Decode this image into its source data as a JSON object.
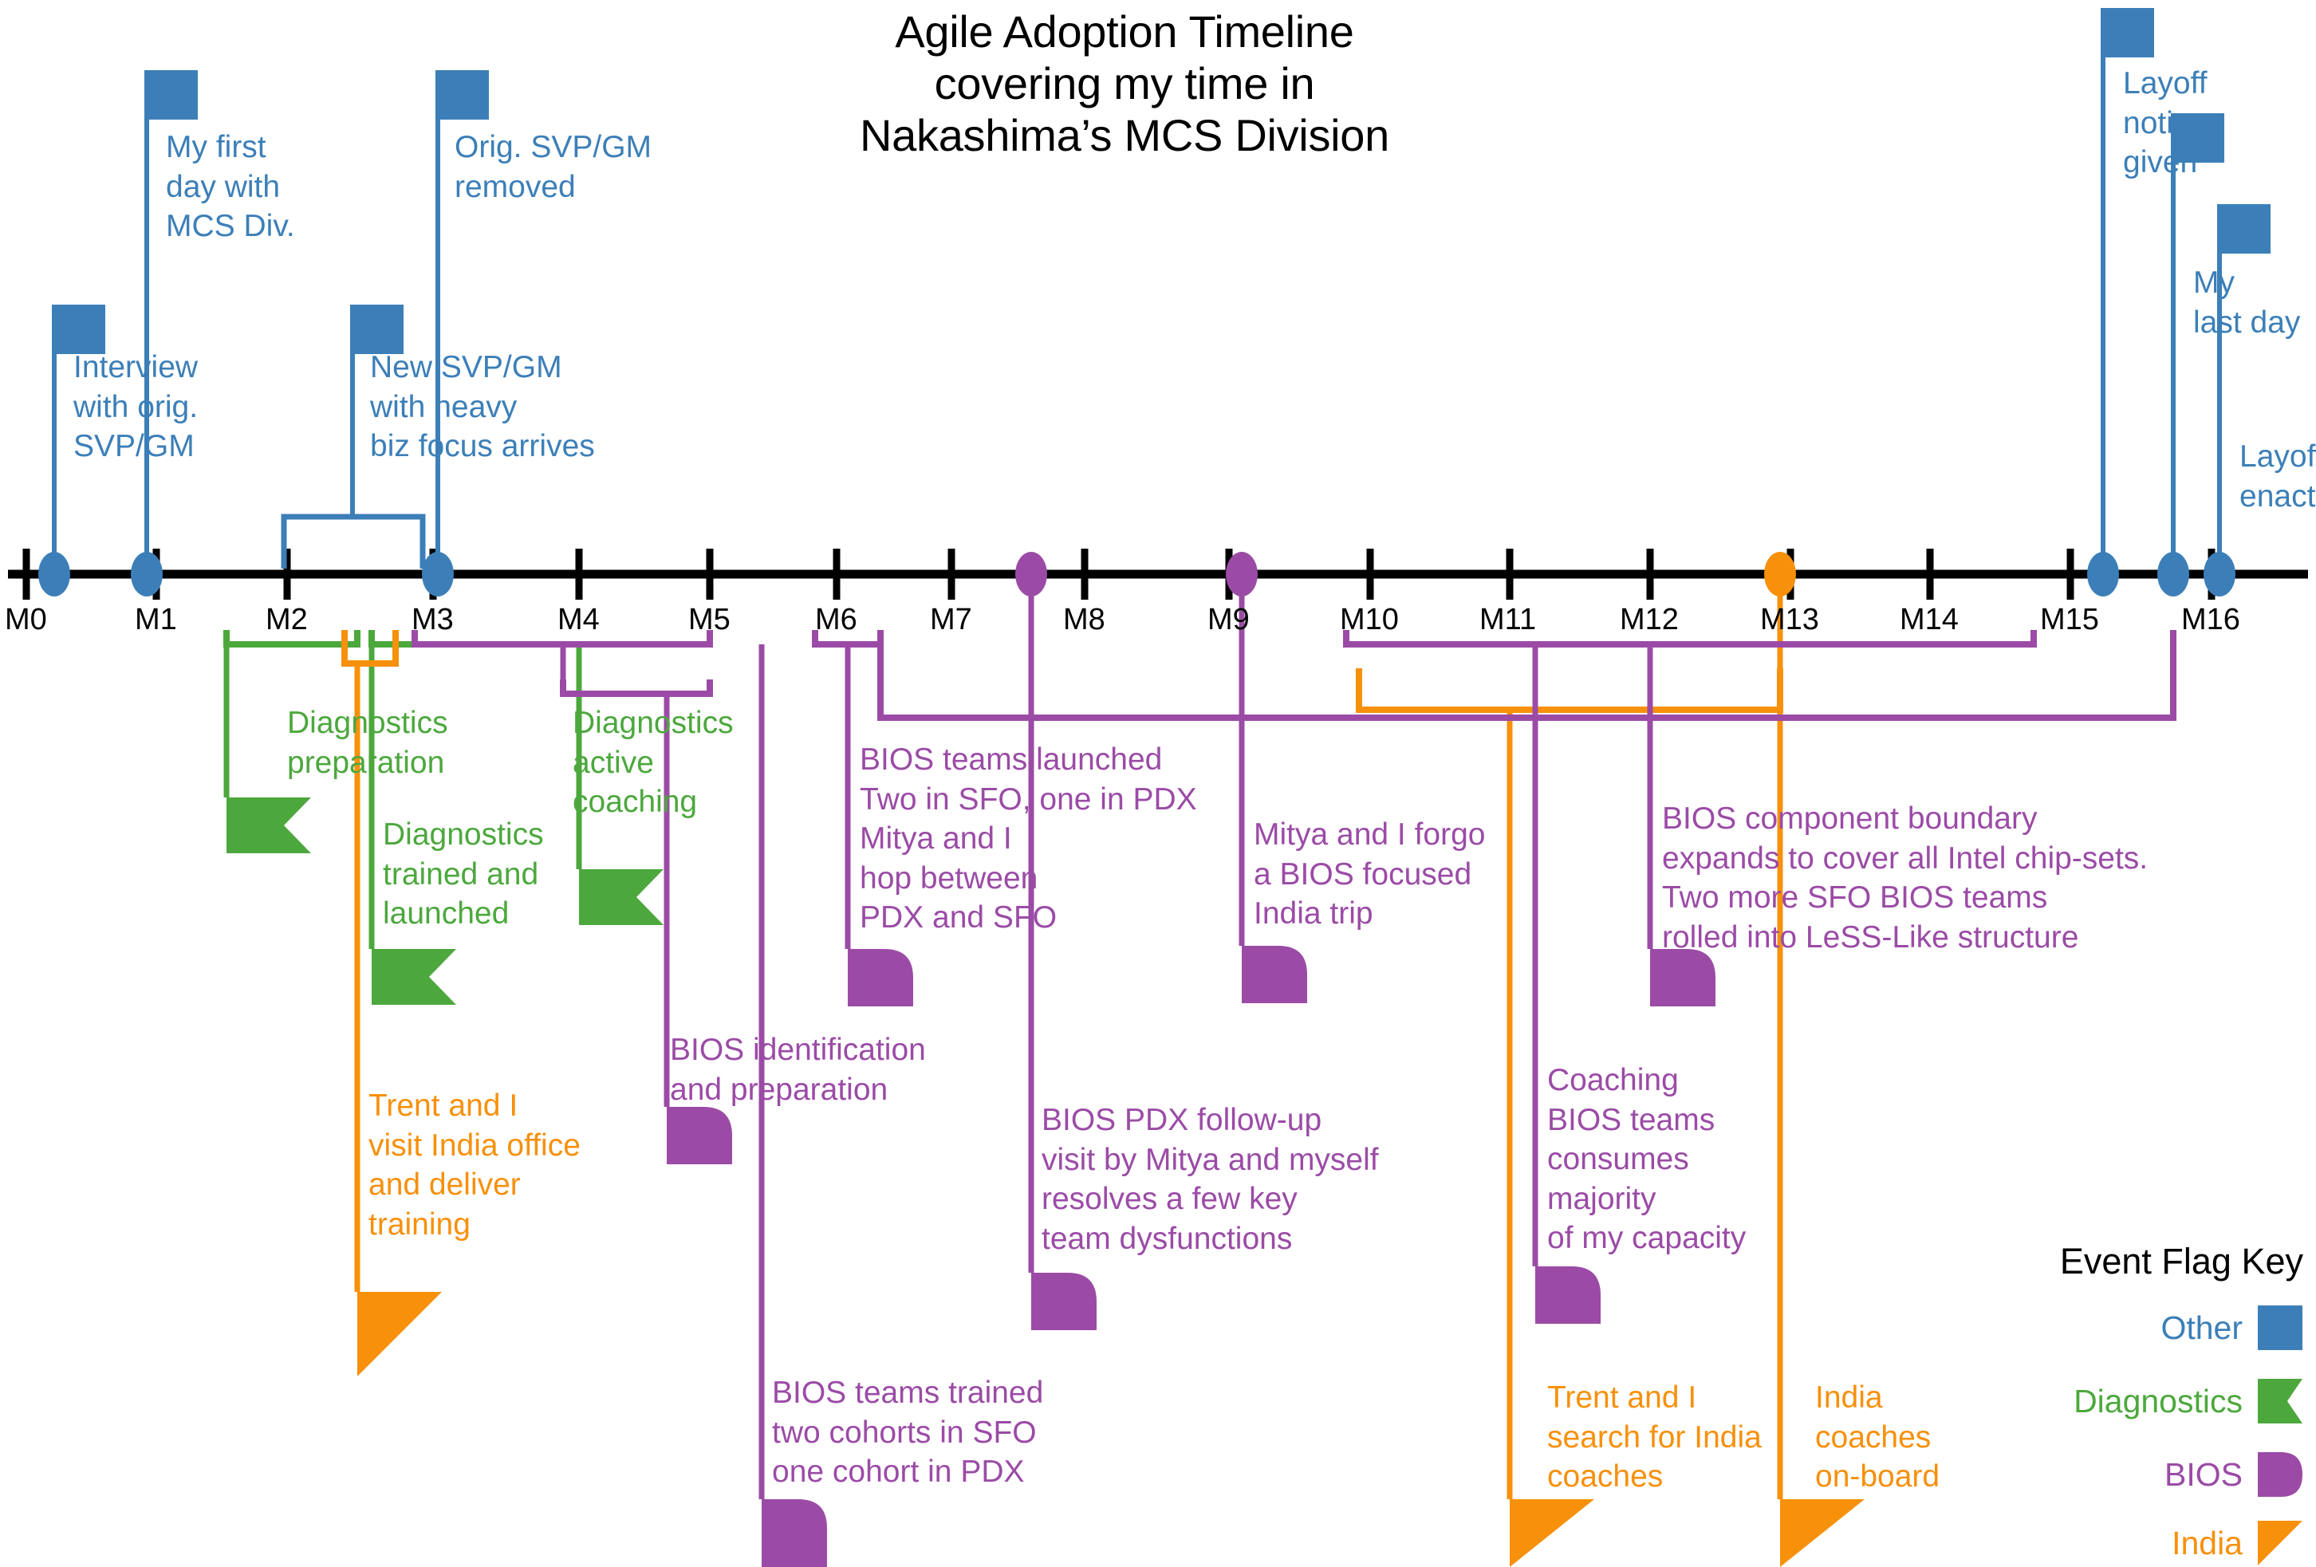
{
  "title": "Agile Adoption Timeline\ncovering my time in\nNakashima’s MCS Division",
  "colors": {
    "other": "#3C7FB8",
    "diagnostics": "#4CA83D",
    "bios": "#9B4BA6",
    "india": "#F7900B",
    "axis": "#000000"
  },
  "axis": {
    "ticks": [
      "M0",
      "M1",
      "M2",
      "M3",
      "M4",
      "M5",
      "M6",
      "M7",
      "M8",
      "M9",
      "M10",
      "M11",
      "M12",
      "M13",
      "M14",
      "M15",
      "M16"
    ]
  },
  "legend": {
    "title": "Event Flag Key",
    "items": [
      {
        "label": "Other",
        "shape": "square-flag-icon",
        "color": "#3C7FB8"
      },
      {
        "label": "Diagnostics",
        "shape": "notched-flag-icon",
        "color": "#4CA83D"
      },
      {
        "label": "BIOS",
        "shape": "rounded-flag-icon",
        "color": "#9B4BA6"
      },
      {
        "label": "India",
        "shape": "triangle-flag-icon",
        "color": "#F7900B"
      }
    ]
  },
  "events": [
    {
      "id": "interview",
      "category": "Other",
      "text": "Interview\nwith orig.\nSVP/GM"
    },
    {
      "id": "first-day",
      "category": "Other",
      "text": "My first\nday with\nMCS Div."
    },
    {
      "id": "new-svp",
      "category": "Other",
      "text": "New SVP/GM\nwith heavy\nbiz focus arrives"
    },
    {
      "id": "orig-svp-removed",
      "category": "Other",
      "text": "Orig. SVP/GM\nremoved"
    },
    {
      "id": "layoff-notices",
      "category": "Other",
      "text": "Layoff\nnotices\ngiven"
    },
    {
      "id": "my-last-day",
      "category": "Other",
      "text": "My\nlast day"
    },
    {
      "id": "layoffs-enacted",
      "category": "Other",
      "text": "Layoffs\nenacted"
    },
    {
      "id": "diag-prep",
      "category": "Diagnostics",
      "text": "Diagnostics\npreparation"
    },
    {
      "id": "diag-trained",
      "category": "Diagnostics",
      "text": "Diagnostics\ntrained and\nlaunched"
    },
    {
      "id": "diag-coaching",
      "category": "Diagnostics",
      "text": "Diagnostics\nactive\ncoaching"
    },
    {
      "id": "india-training",
      "category": "India",
      "text": "Trent and I\nvisit India office\nand deliver\ntraining"
    },
    {
      "id": "bios-ident",
      "category": "BIOS",
      "text": "BIOS identification\nand preparation"
    },
    {
      "id": "bios-launched",
      "category": "BIOS",
      "text": "BIOS teams launched\nTwo in SFO, one in PDX\nMitya and I\nhop between\nPDX and SFO"
    },
    {
      "id": "bios-trained",
      "category": "BIOS",
      "text": "BIOS teams trained\ntwo cohorts in SFO\none cohort in PDX"
    },
    {
      "id": "bios-pdx",
      "category": "BIOS",
      "text": "BIOS PDX follow-up\nvisit by Mitya and myself\nresolves a few key\nteam dysfunctions"
    },
    {
      "id": "forgo-india",
      "category": "BIOS",
      "text": "Mitya and I forgo\na BIOS focused\nIndia trip"
    },
    {
      "id": "coaching-cap",
      "category": "BIOS",
      "text": "Coaching\nBIOS teams\nconsumes\nmajority\nof my capacity"
    },
    {
      "id": "bios-boundary",
      "category": "BIOS",
      "text": "BIOS component boundary\nexpands to cover all Intel chip-sets.\nTwo more SFO BIOS teams\nrolled into LeSS-Like structure"
    },
    {
      "id": "search-coaches",
      "category": "India",
      "text": "Trent and I\nsearch for India\ncoaches"
    },
    {
      "id": "coaches-onboard",
      "category": "India",
      "text": "India\ncoaches\non-board"
    }
  ]
}
